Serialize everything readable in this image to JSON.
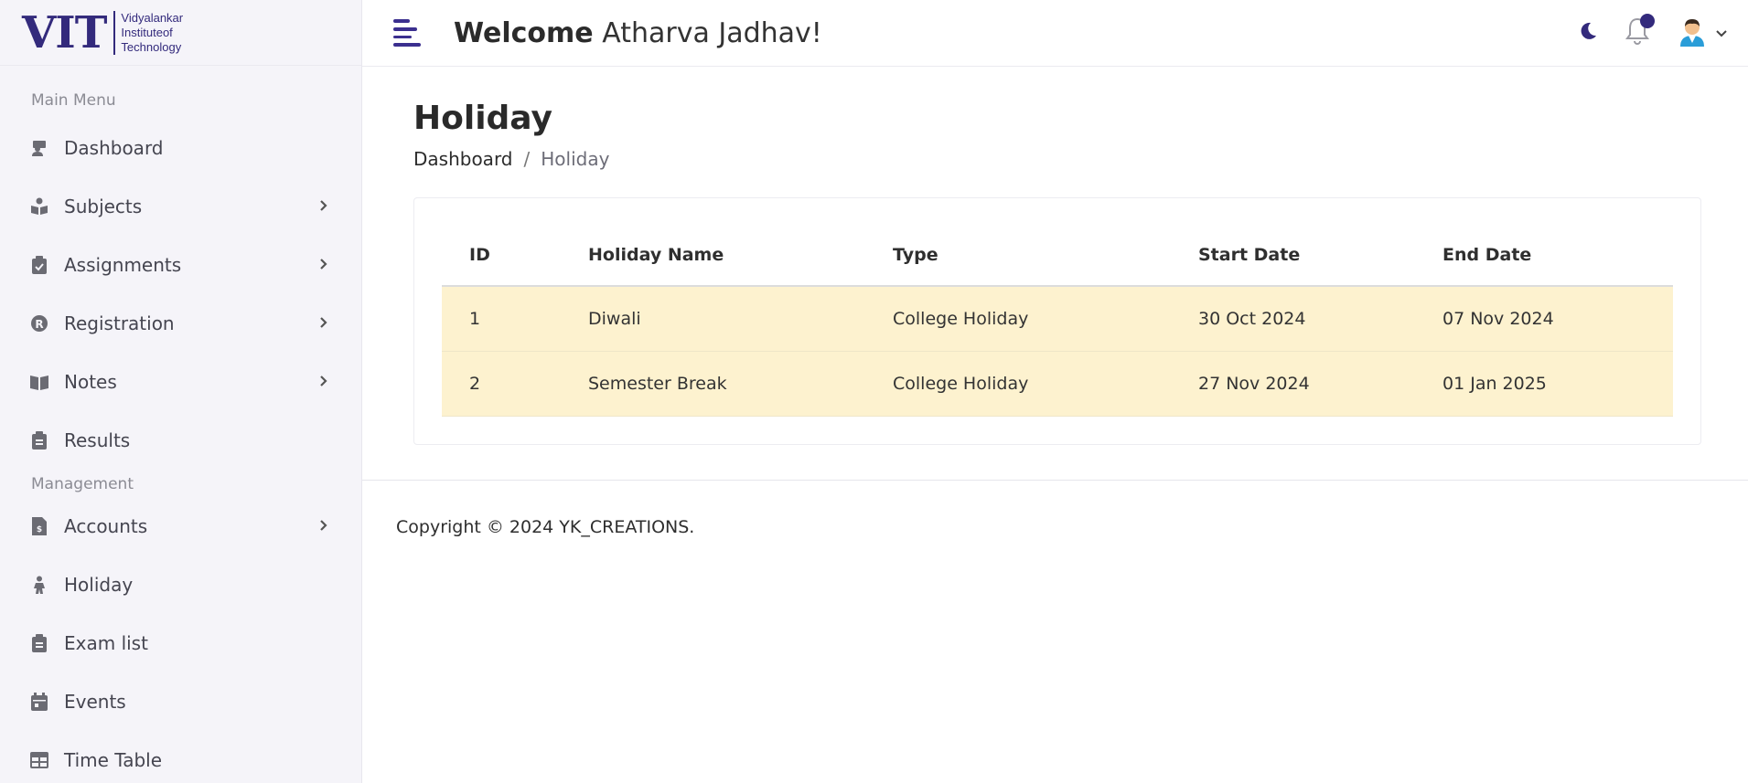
{
  "logo": {
    "mark": "VIT",
    "line1": "Vidyalankar",
    "line2a": "Institute",
    "line2b": "of",
    "line3": "Technology"
  },
  "sidebar": {
    "main_title": "Main Menu",
    "management_title": "Management",
    "main_items": [
      {
        "label": "Dashboard",
        "icon": "teacher-icon",
        "has_submenu": false
      },
      {
        "label": "Subjects",
        "icon": "book-reader-icon",
        "has_submenu": true
      },
      {
        "label": "Assignments",
        "icon": "clipboard-check-icon",
        "has_submenu": true
      },
      {
        "label": "Registration",
        "icon": "registered-icon",
        "has_submenu": true
      },
      {
        "label": "Notes",
        "icon": "book-open-icon",
        "has_submenu": true
      },
      {
        "label": "Results",
        "icon": "clipboard-list-icon",
        "has_submenu": false
      }
    ],
    "management_items": [
      {
        "label": "Accounts",
        "icon": "file-invoice-dollar-icon",
        "has_submenu": true
      },
      {
        "label": "Holiday",
        "icon": "holiday-icon",
        "has_submenu": false
      },
      {
        "label": "Exam list",
        "icon": "clipboard-list-icon",
        "has_submenu": false
      },
      {
        "label": "Events",
        "icon": "calendar-icon",
        "has_submenu": false
      },
      {
        "label": "Time Table",
        "icon": "table-icon",
        "has_submenu": false
      }
    ]
  },
  "header": {
    "welcome_bold": "Welcome",
    "user_name": "Atharva Jadhav!"
  },
  "page": {
    "title": "Holiday",
    "breadcrumb_home": "Dashboard",
    "breadcrumb_sep": "/",
    "breadcrumb_current": "Holiday"
  },
  "table": {
    "headers": {
      "id": "ID",
      "name": "Holiday Name",
      "type": "Type",
      "start": "Start Date",
      "end": "End Date"
    },
    "rows": [
      {
        "id": "1",
        "name": "Diwali",
        "type": "College Holiday",
        "start": "30 Oct 2024",
        "end": "07 Nov 2024"
      },
      {
        "id": "2",
        "name": "Semester Break",
        "type": "College Holiday",
        "start": "27 Nov 2024",
        "end": "01 Jan 2025"
      }
    ]
  },
  "footer": {
    "copyright": "Copyright © 2024 YK_CREATIONS."
  },
  "colors": {
    "brand": "#332a7c",
    "row_highlight": "#fdf2cf",
    "sidebar_bg": "#f5f4f9"
  }
}
